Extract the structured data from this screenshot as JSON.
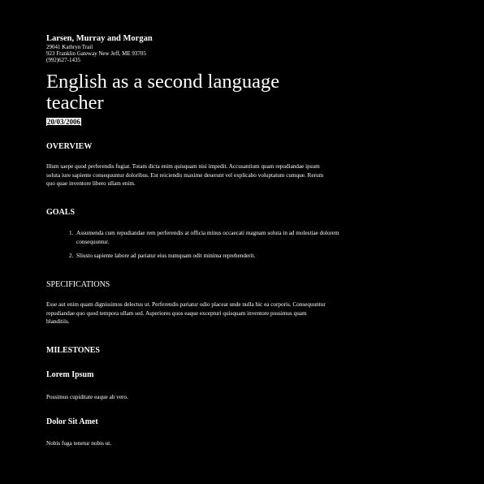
{
  "company": {
    "name": "Larsen, Murray and Morgan",
    "address_line1": "29041 Kathryn Trail",
    "address_line2": "923 Franklin Gateway New Jeff, ME 93705",
    "phone": "(992)627-1435"
  },
  "document": {
    "title": "English as a second language teacher",
    "date": "20/03/2006"
  },
  "overview": {
    "heading": "OVERVIEW",
    "text": "Illum saepe quod perferendis fugiat. Totam dicta enim quisquam nisi impedit. Accusantium quam repudiandae ipsum soluta iure sapiente consequuntur doloribus. Est reiciendis maxime deserunt vel explicabo voluptatum cumque. Rerum quo quae inventore libero ullam enim."
  },
  "goals": {
    "heading": "GOALS",
    "items": [
      {
        "number": "1.",
        "text": "Assumenda cum repudiandae rem perferendis at officia minus occaecati magnam soluta in ad molestiae dolorem consequuntur."
      },
      {
        "number": "2.",
        "text": "Sliusto sapiente labore ad pariatur eius numquam odit minima reprehenderit."
      }
    ]
  },
  "specifications": {
    "heading": "SPECIFICATIONS",
    "text": "Esse aut enim quam dignissimos delectus ut. Perferendis pariatur odio placeat unde nulla hic ea corporis. Consequuntur repudiandae quo quod tempora ullam sed. Asperiores quos eaque excepturi quisquam inventore possimus quam blanditiis."
  },
  "milestones": {
    "heading": "MILESTONES",
    "items": [
      {
        "title": "Lorem Ipsum",
        "text": "Possimus cupiditate eaque ab vero."
      },
      {
        "title": "Dolor Sit Amet",
        "text": "Nobis fuga tenetur nobis ut."
      }
    ]
  }
}
